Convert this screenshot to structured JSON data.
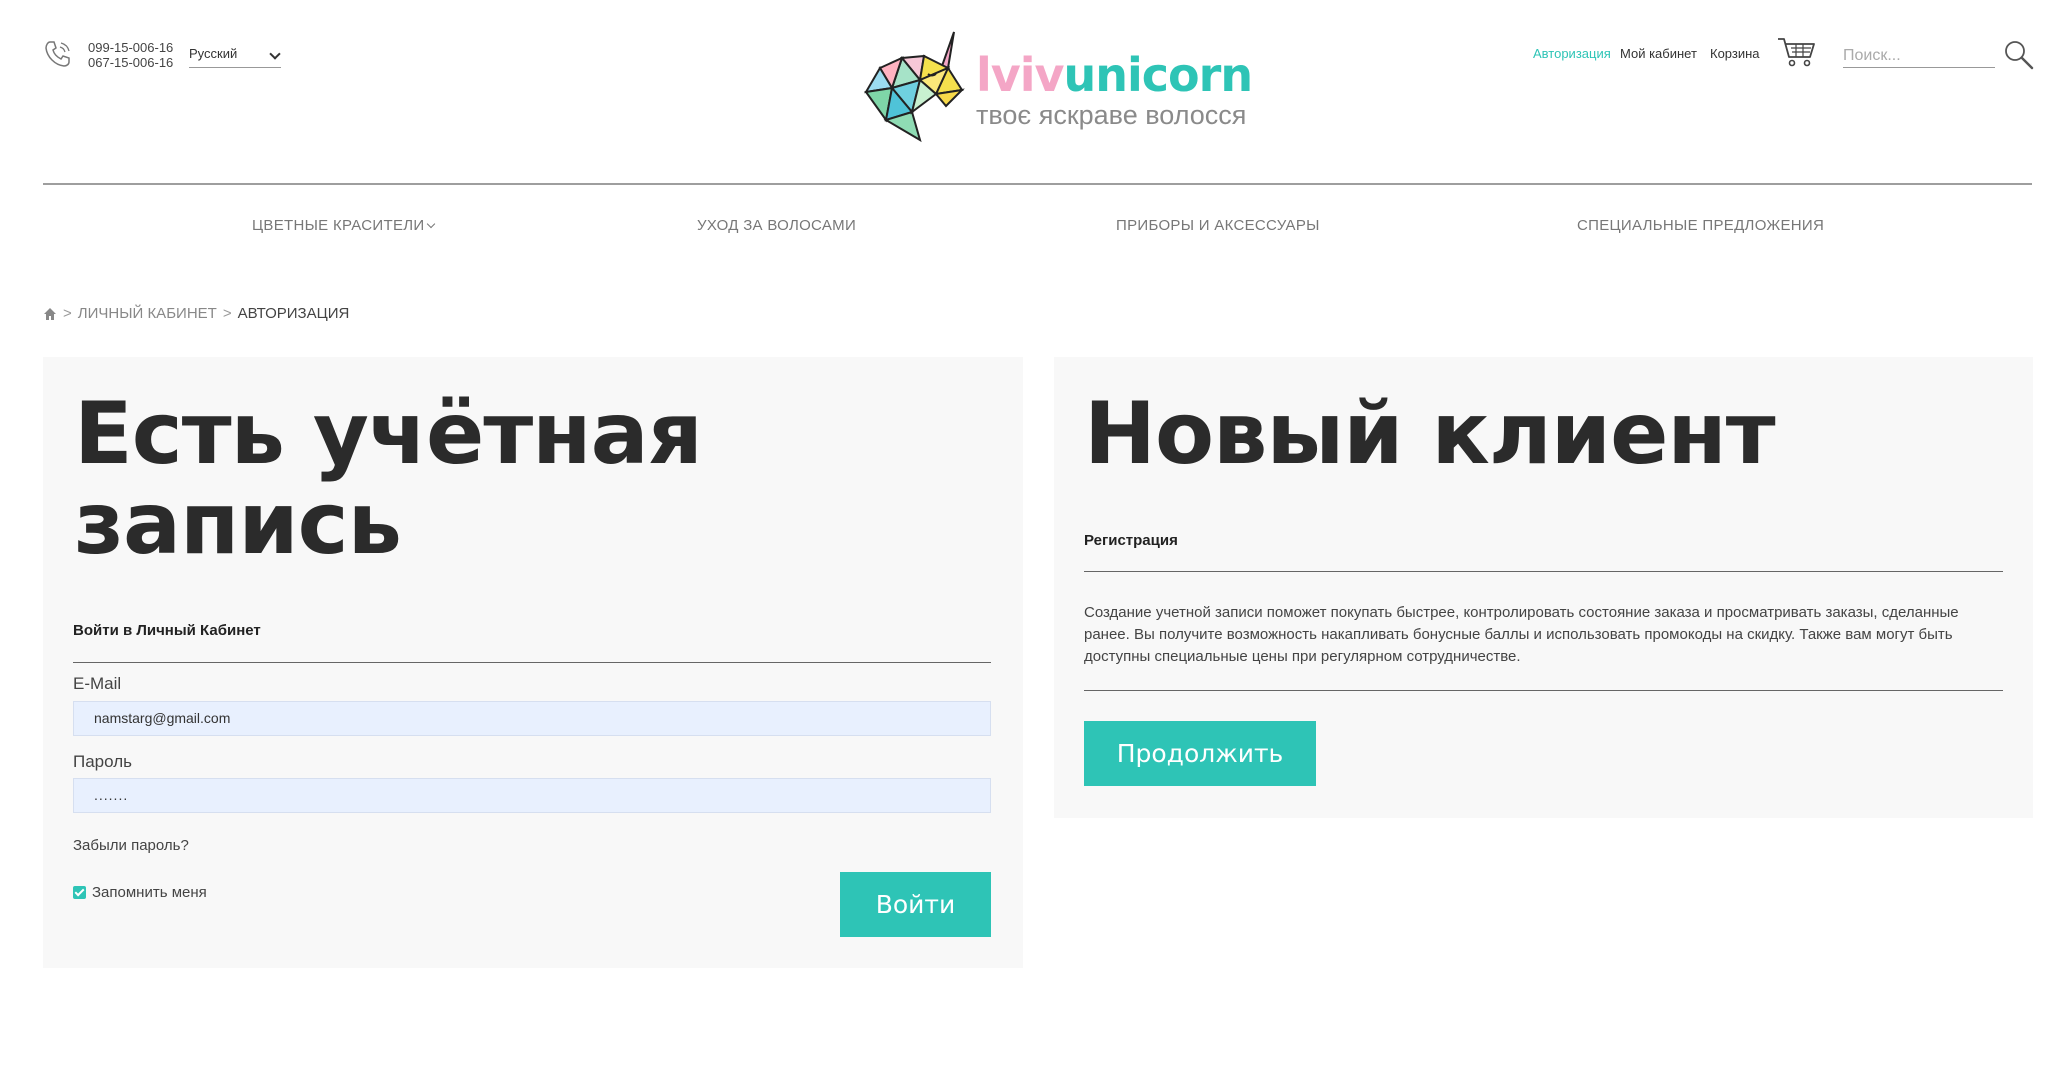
{
  "header": {
    "phones": [
      "099-15-006-16",
      "067-15-006-16"
    ],
    "language": "Русский",
    "logo": {
      "brand_part1": "lviv",
      "brand_part2": "unicorn",
      "tagline": "твоє яскраве волосся"
    },
    "links": {
      "auth": "Авторизация",
      "cabinet": "Мой кабинет",
      "cart": "Корзина"
    },
    "search": {
      "placeholder": "Поиск..."
    },
    "icons": [
      "phone-icon",
      "cart-icon",
      "search-icon"
    ],
    "accent_color": "#2ec4b6"
  },
  "nav": {
    "items": [
      {
        "label": "ЦВЕТНЫЕ КРАСИТЕЛИ",
        "has_dropdown": true
      },
      {
        "label": "УХОД ЗА ВОЛОСАМИ"
      },
      {
        "label": "ПРИБОРЫ И АКСЕССУАРЫ"
      },
      {
        "label": "СПЕЦИАЛЬНЫЕ ПРЕДЛОЖЕНИЯ"
      }
    ]
  },
  "breadcrumb": {
    "items": [
      "ЛИЧНЫЙ КАБИНЕТ",
      "АВТОРИЗАЦИЯ"
    ],
    "separator": ">"
  },
  "login": {
    "title": "Есть учётная запись",
    "subtitle": "Войти в Личный Кабинет",
    "email_label": "E-Mail",
    "email_value": "namstarg@gmail.com",
    "password_label": "Пароль",
    "password_value": ".......",
    "forgot": "Забыли пароль?",
    "remember": "Запомнить меня",
    "remember_checked": true,
    "submit": "Войти"
  },
  "register": {
    "title": "Новый клиент",
    "subtitle": "Регистрация",
    "description": "Создание учетной записи поможет покупать быстрее, контролировать состояние заказа и просматривать заказы, сделанные ранее. Вы получите возможность накапливать бонусные баллы и использовать промокоды на скидку. Также вам могут быть доступны специальные цены при регулярном сотрудничестве.",
    "button": "Продолжить"
  }
}
